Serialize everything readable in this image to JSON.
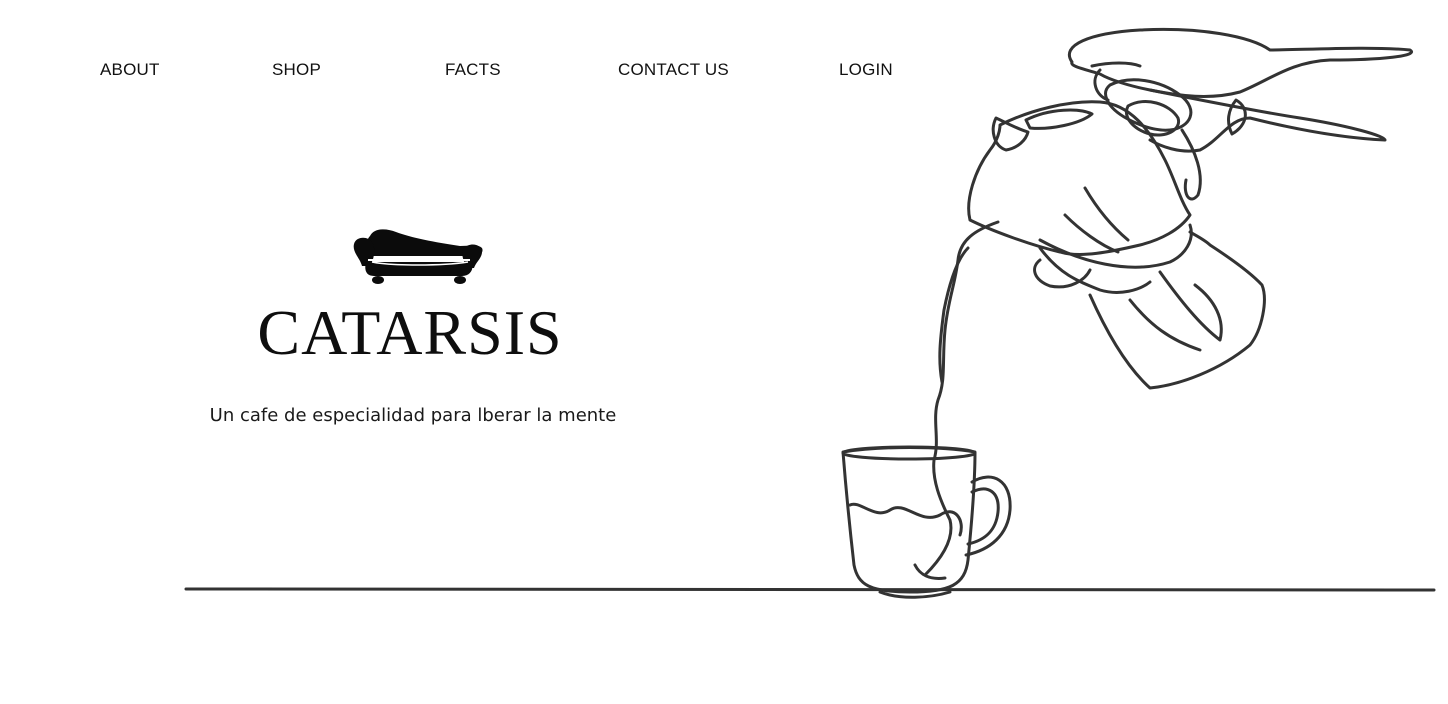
{
  "nav": {
    "items": [
      {
        "label": "ABOUT"
      },
      {
        "label": "SHOP"
      },
      {
        "label": "FACTS"
      },
      {
        "label": "CONTACT US"
      },
      {
        "label": "LOGIN"
      }
    ]
  },
  "hero": {
    "logo_icon": "sofa-icon",
    "brand": "CATARSIS",
    "tagline": "Un cafe de especialidad para lberar la mente"
  },
  "illustration": {
    "icon": "coffee-pot-pouring-into-cup-line-drawing",
    "stroke_color": "#333333"
  },
  "colors": {
    "background": "#ffffff",
    "text": "#111111"
  }
}
